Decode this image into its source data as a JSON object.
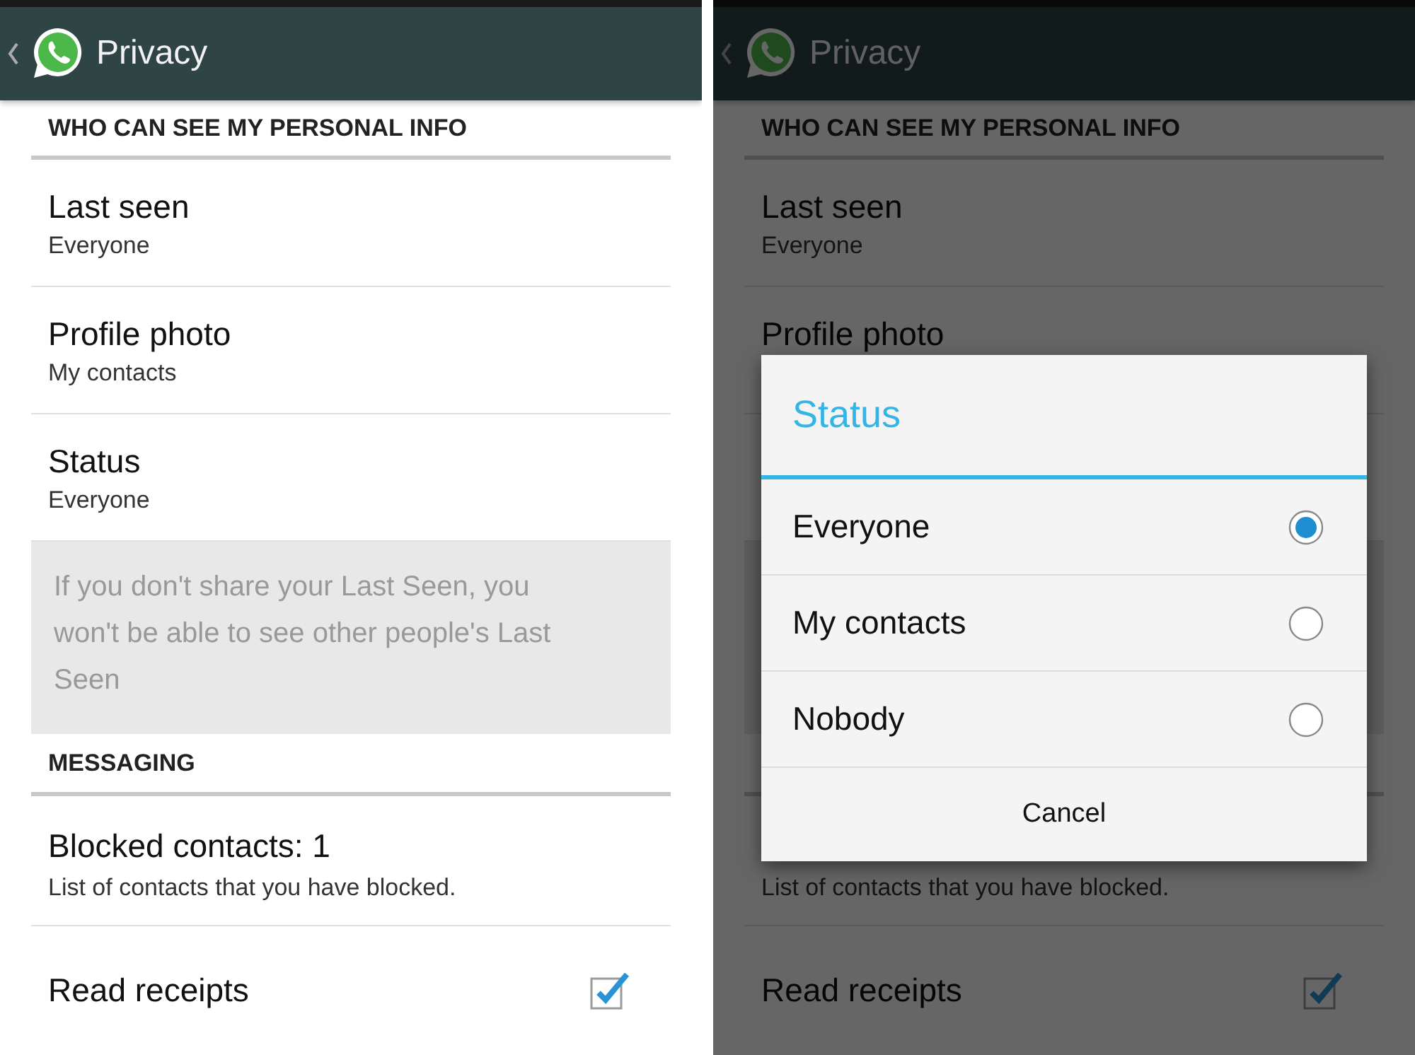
{
  "screens": [
    {
      "dimmed": false,
      "title": "Privacy",
      "rows": [
        {
          "kind": "header",
          "text": "WHO CAN SEE MY PERSONAL INFO"
        },
        {
          "kind": "setting",
          "title": "Last seen",
          "subtitle": "Everyone"
        },
        {
          "kind": "setting",
          "title": "Profile photo",
          "subtitle": "My contacts"
        },
        {
          "kind": "setting",
          "title": "Status",
          "subtitle": "Everyone"
        },
        {
          "kind": "note",
          "text": "If you don't share your Last Seen, you won't be able to see other people's Last Seen"
        },
        {
          "kind": "header",
          "text": "MESSAGING"
        },
        {
          "kind": "setting",
          "title": "Blocked contacts: 1",
          "subtitle": "List of contacts that you have blocked."
        },
        {
          "kind": "checkbox",
          "title": "Read receipts",
          "checked": true
        }
      ]
    },
    {
      "dimmed": true,
      "title": "Privacy",
      "rows": [
        {
          "kind": "header",
          "text": "WHO CAN SEE MY PERSONAL INFO"
        },
        {
          "kind": "setting",
          "title": "Last seen",
          "subtitle": "Everyone"
        },
        {
          "kind": "setting",
          "title": "Profile photo"
        },
        {
          "kind": "setting"
        },
        {
          "kind": "note"
        },
        {
          "kind": "header"
        },
        {
          "kind": "setting",
          "subtitle": "List of contacts that you have blocked."
        },
        {
          "kind": "checkbox",
          "title": "Read receipts",
          "checked": true
        }
      ],
      "dialog": {
        "title": "Status",
        "options": [
          {
            "label": "Everyone",
            "selected": true
          },
          {
            "label": "My contacts",
            "selected": false
          },
          {
            "label": "Nobody",
            "selected": false
          }
        ],
        "cancel": "Cancel"
      }
    }
  ]
}
